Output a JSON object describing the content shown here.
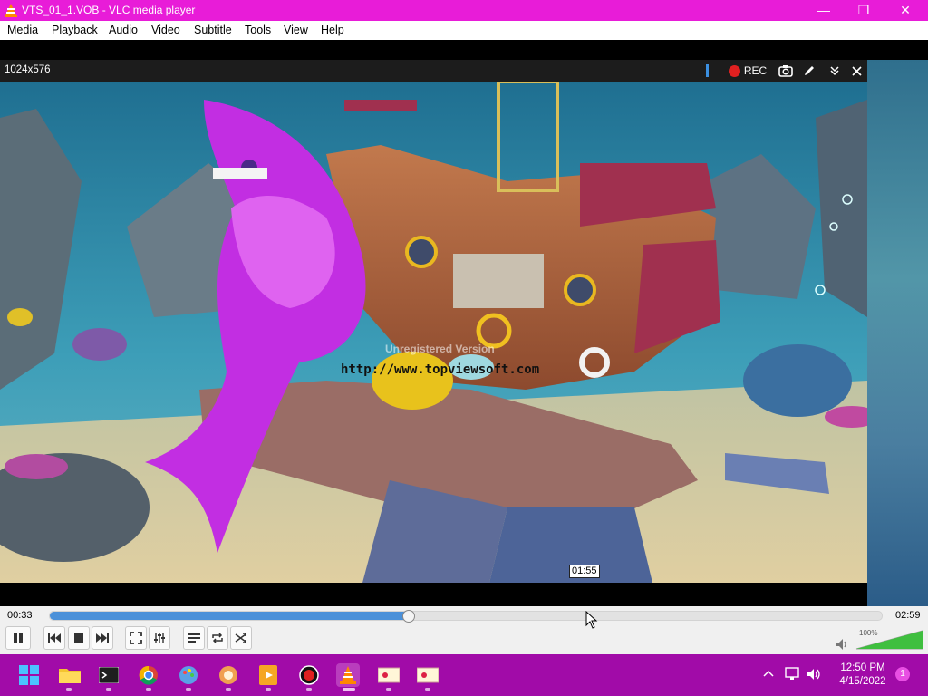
{
  "window": {
    "title": "VTS_01_1.VOB - VLC media player"
  },
  "menu": [
    "Media",
    "Playback",
    "Audio",
    "Video",
    "Subtitle",
    "Tools",
    "View",
    "Help"
  ],
  "overlay": {
    "resolution": "1024x576",
    "rec_label": "REC"
  },
  "video": {
    "watermark_text": "http://www.topviewsoft.com",
    "watermark_faint": "Unregistered Version"
  },
  "player": {
    "elapsed": "00:33",
    "total": "02:59",
    "hover_time": "01:55",
    "progress_fraction": 0.43,
    "volume_label": "100%",
    "volume_fraction": 1.0
  },
  "taskbar": {
    "time": "12:50 PM",
    "date": "4/15/2022",
    "notification_count": "1",
    "apps": [
      "start",
      "file-explorer",
      "terminal",
      "chrome",
      "paint",
      "photos",
      "media",
      "recorder",
      "vlc",
      "app-1",
      "app-2"
    ]
  },
  "colors": {
    "titlebar": "#e81cd8",
    "taskbar": "#a10ba8",
    "seek_fill": "#4a90d9",
    "rec": "#e02020"
  }
}
